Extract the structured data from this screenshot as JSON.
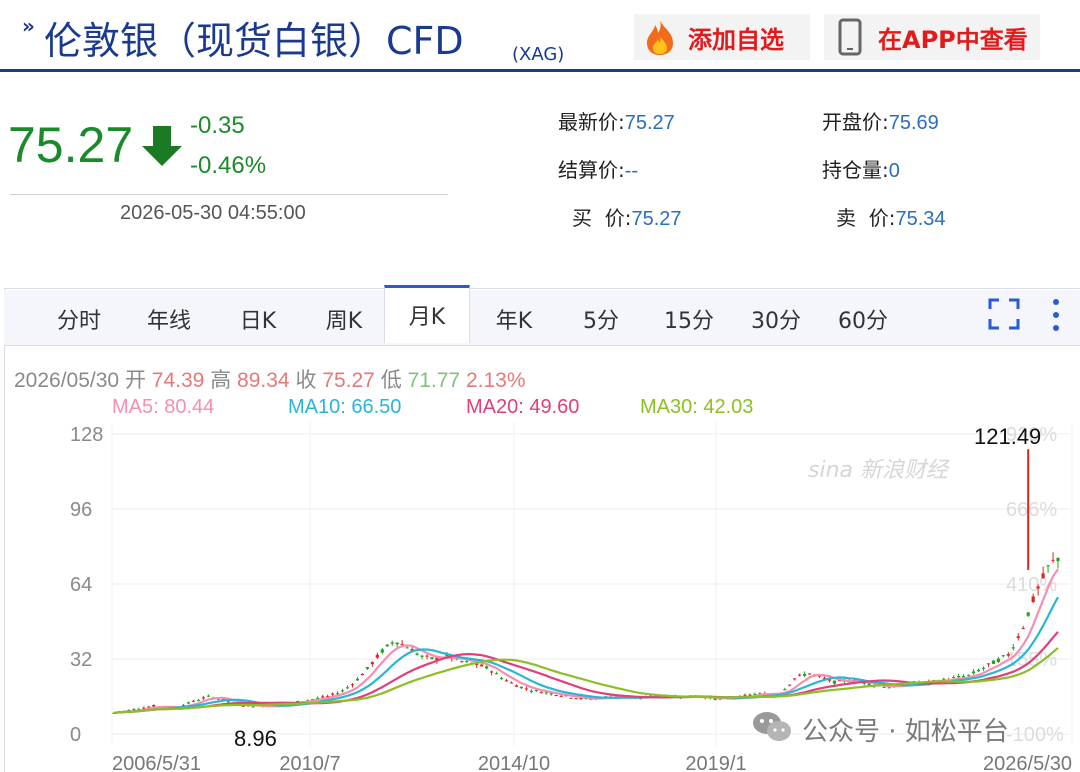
{
  "header": {
    "title": "伦敦银（现货白银）CFD",
    "title_sub": "(XAG)",
    "add_label": "添加自选",
    "app_label": "在APP中查看"
  },
  "quote": {
    "price": "75.27",
    "change": "-0.35",
    "change_pct": "-0.46%",
    "time": "2026-05-30 04:55:00",
    "stats": [
      {
        "key": "最新价:",
        "value": "75.27"
      },
      {
        "key": "开盘价:",
        "value": "75.69"
      },
      {
        "key": "结算价:",
        "value": "--"
      },
      {
        "key": "持仓量:",
        "value": "0"
      },
      {
        "key": "买  价:",
        "value": "75.27"
      },
      {
        "key": "卖  价:",
        "value": "75.34"
      }
    ]
  },
  "tabs": [
    "分时",
    "年线",
    "日K",
    "周K",
    "月K",
    "年K",
    "5分",
    "15分",
    "30分",
    "60分"
  ],
  "active_tab": "月K",
  "bar_info": {
    "date": "2026/05/30",
    "open_label": "开",
    "open": "74.39",
    "high_label": "高",
    "high": "89.34",
    "close_label": "收",
    "close": "75.27",
    "low_label": "低",
    "low": "71.77",
    "pct": "2.13%"
  },
  "ma": [
    {
      "label": "MA5: 80.44",
      "color": "#f48fb1"
    },
    {
      "label": "MA10: 66.50",
      "color": "#29b6d6"
    },
    {
      "label": "MA20: 49.60",
      "color": "#e0407a"
    },
    {
      "label": "MA30: 42.03",
      "color": "#8cbf26"
    }
  ],
  "chart_data": {
    "type": "candlestick",
    "y_ticks": [
      "128",
      "96",
      "64",
      "32",
      "0"
    ],
    "y_values": [
      128,
      96,
      64,
      32,
      0
    ],
    "pct_ticks": [
      "920%",
      "666%",
      "410%",
      "155%",
      "-100%"
    ],
    "x_labels": [
      "2006/5/31",
      "2010/7",
      "2014/10",
      "2019/1",
      "2026/5/30"
    ],
    "ylim": [
      0,
      128
    ],
    "max_label": "121.49",
    "min_label": "8.96",
    "grid": true
  },
  "watermark": "sina 新浪财经",
  "wechat_label": "公众号 · 如松平台"
}
